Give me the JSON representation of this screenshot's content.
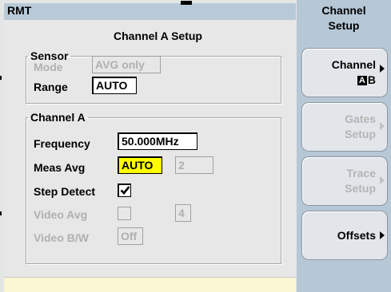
{
  "status": {
    "mode_indicator": "RMT"
  },
  "panel": {
    "title": "Channel A Setup",
    "sensor": {
      "legend": "Sensor",
      "mode_label": "Mode",
      "mode_value": "AVG only",
      "range_label": "Range",
      "range_value": "AUTO"
    },
    "channel": {
      "legend": "Channel A",
      "frequency_label": "Frequency",
      "frequency_value": "50.000MHz",
      "meas_avg_label": "Meas Avg",
      "meas_avg_value": "AUTO",
      "meas_avg_count": "2",
      "step_detect_label": "Step Detect",
      "step_detect_checked": true,
      "video_avg_label": "Video Avg",
      "video_avg_checked": false,
      "video_avg_count": "4",
      "video_bw_label": "Video B/W",
      "video_bw_value": "Off"
    }
  },
  "softkeys": {
    "header_line1": "Channel",
    "header_line2": "Setup",
    "channel": {
      "line1": "Channel",
      "badge": "A",
      "line2": "B",
      "enabled": true
    },
    "gates": {
      "line1": "Gates",
      "line2": "Setup",
      "enabled": false
    },
    "trace": {
      "line1": "Trace",
      "line2": "Setup",
      "enabled": false
    },
    "offsets": {
      "line1": "Offsets",
      "enabled": true
    }
  },
  "colors": {
    "softkey_column": "#b6c7d6",
    "status_bar": "#b8cad8",
    "panel_bg": "#e7e7e7",
    "highlight": "#ffff00",
    "bottom_strip": "#fbf6d4"
  }
}
